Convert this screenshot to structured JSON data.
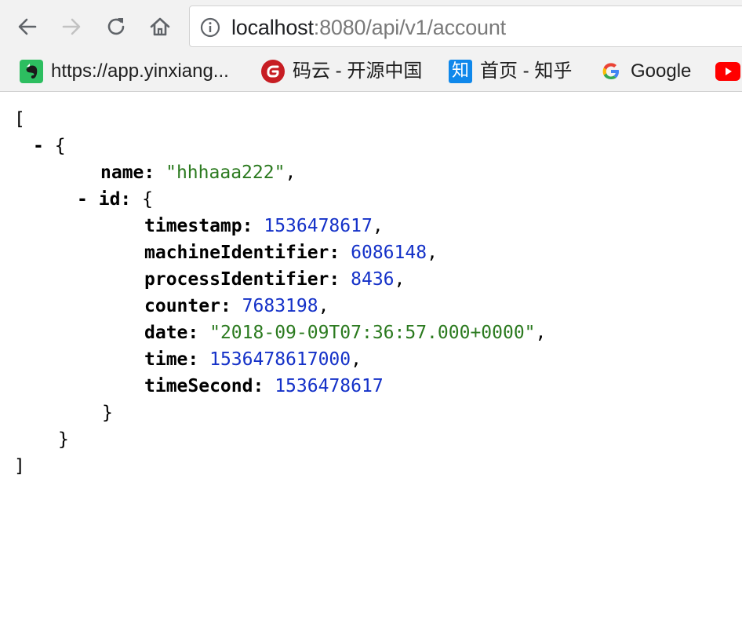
{
  "browser": {
    "url_host": "localhost",
    "url_rest": ":8080/api/v1/account",
    "icons": [
      "back-arrow-icon",
      "forward-arrow-icon",
      "reload-icon",
      "home-icon",
      "info-icon"
    ]
  },
  "bookmarks": [
    {
      "label": "https://app.yinxiang...",
      "icon": "evernote-icon"
    },
    {
      "label": "码云 - 开源中国",
      "icon": "gitee-icon"
    },
    {
      "label": "首页 - 知乎",
      "icon": "zhihu-icon",
      "icon_text": "知"
    },
    {
      "label": "Google",
      "icon": "google-icon"
    },
    {
      "label": "",
      "icon": "youtube-icon"
    }
  ],
  "json_view": {
    "open_bracket": "[",
    "close_bracket": "]",
    "toggle": "-",
    "item_open": "{",
    "item_close": "}",
    "name_key": "name",
    "name_value": "\"hhhaaa222\"",
    "id_key": "id",
    "id_open": "{",
    "id_close": "}",
    "id_fields": [
      {
        "key": "timestamp",
        "value": "1536478617",
        "type": "number",
        "comma": ","
      },
      {
        "key": "machineIdentifier",
        "value": "6086148",
        "type": "number",
        "comma": ","
      },
      {
        "key": "processIdentifier",
        "value": "8436",
        "type": "number",
        "comma": ","
      },
      {
        "key": "counter",
        "value": "7683198",
        "type": "number",
        "comma": ","
      },
      {
        "key": "date",
        "value": "\"2018-09-09T07:36:57.000+0000\"",
        "type": "string",
        "comma": ","
      },
      {
        "key": "time",
        "value": "1536478617000",
        "type": "number",
        "comma": ","
      },
      {
        "key": "timeSecond",
        "value": "1536478617",
        "type": "number",
        "comma": ""
      }
    ]
  },
  "colors": {
    "string": "#2b7a1f",
    "number": "#1431c8",
    "toolbar": "#f2f2f2"
  }
}
